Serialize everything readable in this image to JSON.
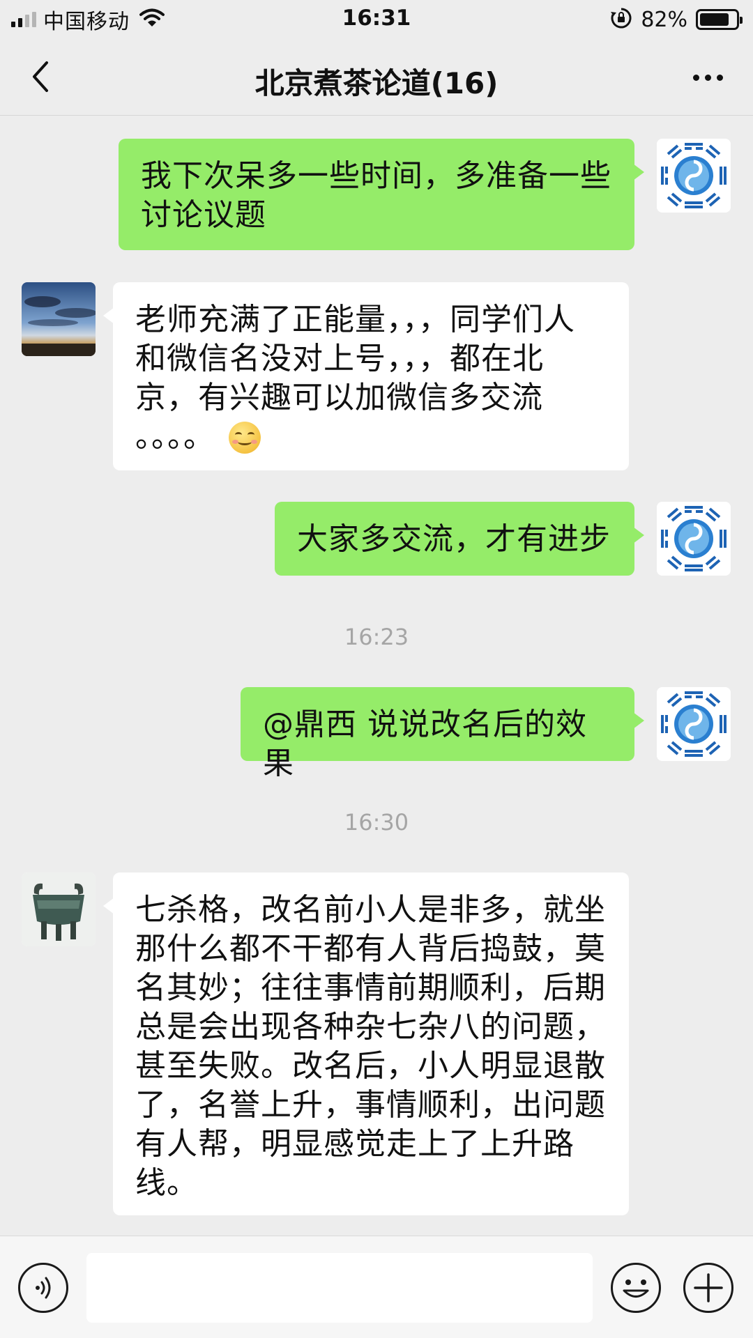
{
  "status_bar": {
    "carrier": "中国移动",
    "time": "16:31",
    "battery_percent": "82%",
    "battery_level": 0.82,
    "signal_bars": 4,
    "signal_strength": 2,
    "icons": [
      "signal-icon",
      "wifi-icon",
      "rotation-lock-icon",
      "battery-icon"
    ]
  },
  "nav": {
    "title": "北京煮茶论道(16)",
    "back_icon": "chevron-left-icon",
    "more_icon": "more-icon"
  },
  "messages": [
    {
      "direction": "out",
      "text_lines": [
        "我下次呆多一些时间，多准备一些",
        "讨论议题"
      ],
      "avatar": "taiji-bagua-avatar"
    },
    {
      "direction": "in",
      "text_lines": [
        "老师充满了正能量，，，同学们人",
        "和微信名没对上号，，，都在北",
        "京，有兴趣可以加微信多交流",
        "。。。。"
      ],
      "has_emoji": true,
      "emoji": "smile-emoji",
      "avatar": "sky-landscape-avatar"
    },
    {
      "direction": "out",
      "text_lines": [
        "大家多交流，才有进步"
      ],
      "avatar": "taiji-bagua-avatar"
    },
    {
      "timestamp": "16:23"
    },
    {
      "direction": "out",
      "text_lines": [
        "@鼎西 说说改名后的效果"
      ],
      "avatar": "taiji-bagua-avatar"
    },
    {
      "timestamp": "16:30"
    },
    {
      "direction": "in",
      "text_lines": [
        "七杀格，改名前小人是非多，就坐",
        "那什么都不干都有人背后捣鼓，莫",
        "名其妙；往往事情前期顺利，后期",
        "总是会出现各种杂七杂八的问题，",
        "甚至失败。改名后，小人明显退散",
        "了，名誉上升，事情顺利，出问题",
        "有人帮，明显感觉走上了上升路",
        "线。"
      ],
      "avatar": "bronze-ding-avatar"
    }
  ],
  "input_bar": {
    "voice_icon": "voice-icon",
    "emoji_icon": "emoji-icon",
    "plus_icon": "plus-icon",
    "input_value": ""
  },
  "colors": {
    "background": "#ededed",
    "outgoing_bubble": "#95ec69",
    "incoming_bubble": "#ffffff",
    "timestamp_text": "#a5a5a5"
  }
}
